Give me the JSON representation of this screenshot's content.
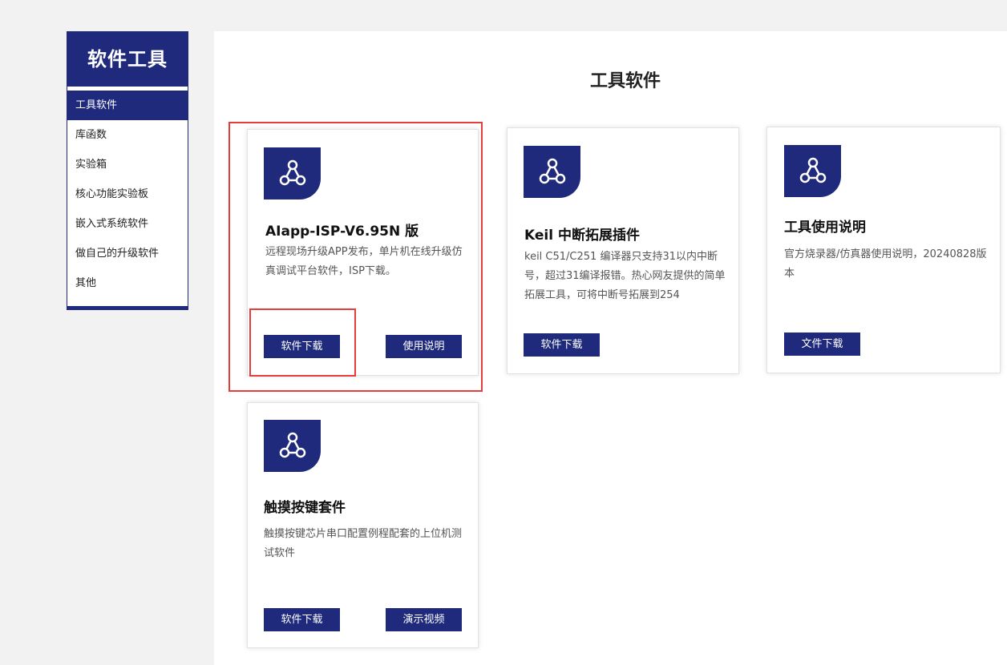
{
  "sidebar": {
    "title": "软件工具",
    "items": [
      {
        "label": "工具软件",
        "active": true
      },
      {
        "label": "库函数"
      },
      {
        "label": "实验箱"
      },
      {
        "label": "核心功能实验板"
      },
      {
        "label": "嵌入式系统软件"
      },
      {
        "label": "做自己的升级软件"
      },
      {
        "label": "其他"
      }
    ]
  },
  "main": {
    "title": "工具软件",
    "cards": [
      {
        "title": "AIapp-ISP-V6.95N 版",
        "description": "远程现场升级APP发布，单片机在线升级仿真调试平台软件，ISP下载。",
        "icon": "share-network-icon",
        "buttons": [
          "软件下载",
          "使用说明"
        ]
      },
      {
        "title": "Keil 中断拓展插件",
        "description": "keil C51/C251 编译器只支持31以内中断号，超过31编译报错。热心网友提供的简单拓展工具，可将中断号拓展到254",
        "icon": "share-network-icon",
        "buttons": [
          "软件下载"
        ]
      },
      {
        "title": "工具使用说明",
        "description": "官方烧录器/仿真器使用说明，20240828版本",
        "icon": "share-network-icon",
        "buttons": [
          "文件下载"
        ]
      },
      {
        "title": "触摸按键套件",
        "description": "触摸按键芯片串口配置例程配套的上位机测试软件",
        "icon": "share-network-icon",
        "buttons": [
          "软件下载",
          "演示视频"
        ]
      }
    ]
  },
  "colors": {
    "brand": "#1f2a7c",
    "highlight": "#e53c3c",
    "background": "#f2f2f2"
  }
}
